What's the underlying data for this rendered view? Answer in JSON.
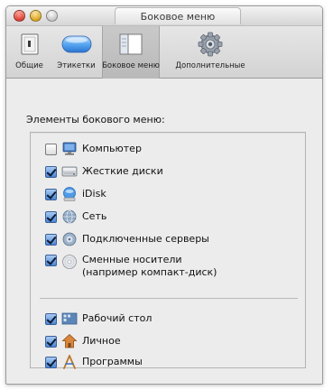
{
  "window": {
    "title": "Боковое меню"
  },
  "toolbar": {
    "items": [
      {
        "label": "Общие",
        "icon": "general-icon",
        "selected": false
      },
      {
        "label": "Этикетки",
        "icon": "labels-icon",
        "selected": false
      },
      {
        "label": "Боковое меню",
        "icon": "sidebar-icon",
        "selected": true
      },
      {
        "label": "Дополнительные",
        "icon": "advanced-gear-icon",
        "selected": false
      }
    ]
  },
  "main": {
    "section_label": "Элементы бокового меню:",
    "items": [
      {
        "label": "Компьютер",
        "checked": false,
        "icon": "computer-icon"
      },
      {
        "label": "Жесткие диски",
        "checked": true,
        "icon": "hard-disk-icon"
      },
      {
        "label": "iDisk",
        "checked": true,
        "icon": "idisk-icon"
      },
      {
        "label": "Сеть",
        "checked": true,
        "icon": "network-icon"
      },
      {
        "label": "Подключенные серверы",
        "checked": true,
        "icon": "server-icon"
      },
      {
        "label": "Сменные носители",
        "label2": "(например компакт-диск)",
        "checked": true,
        "icon": "cd-icon"
      },
      {
        "label": "Рабочий стол",
        "checked": true,
        "icon": "desktop-icon"
      },
      {
        "label": "Личное",
        "checked": true,
        "icon": "home-icon"
      },
      {
        "label": "Программы",
        "checked": true,
        "icon": "applications-icon"
      }
    ]
  },
  "colors": {
    "window_bg": "#ececec",
    "checkbox_checked": "#4a86d4",
    "close_button": "#d7382c",
    "minimize_button": "#d6a017",
    "zoom_button": "#c3c3c3"
  }
}
